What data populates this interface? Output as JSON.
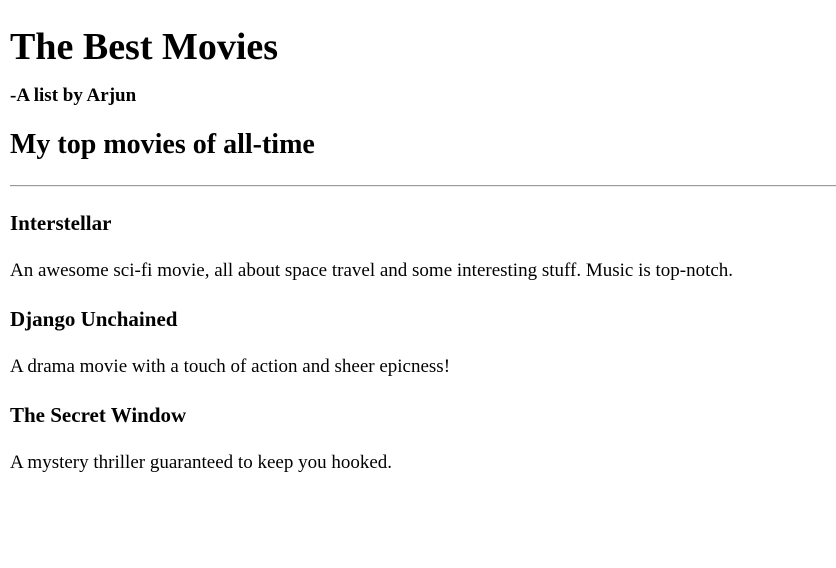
{
  "page": {
    "title": "The Best Movies",
    "byline": "-A list by Arjun",
    "section_heading": "My top movies of all-time"
  },
  "movies": [
    {
      "title": "Interstellar",
      "description": "An awesome sci-fi movie, all about space travel and some interesting stuff. Music is top-notch."
    },
    {
      "title": "Django Unchained",
      "description": "A drama movie with a touch of action and sheer epicness!"
    },
    {
      "title": "The Secret Window",
      "description": "A mystery thriller guaranteed to keep you hooked."
    }
  ]
}
